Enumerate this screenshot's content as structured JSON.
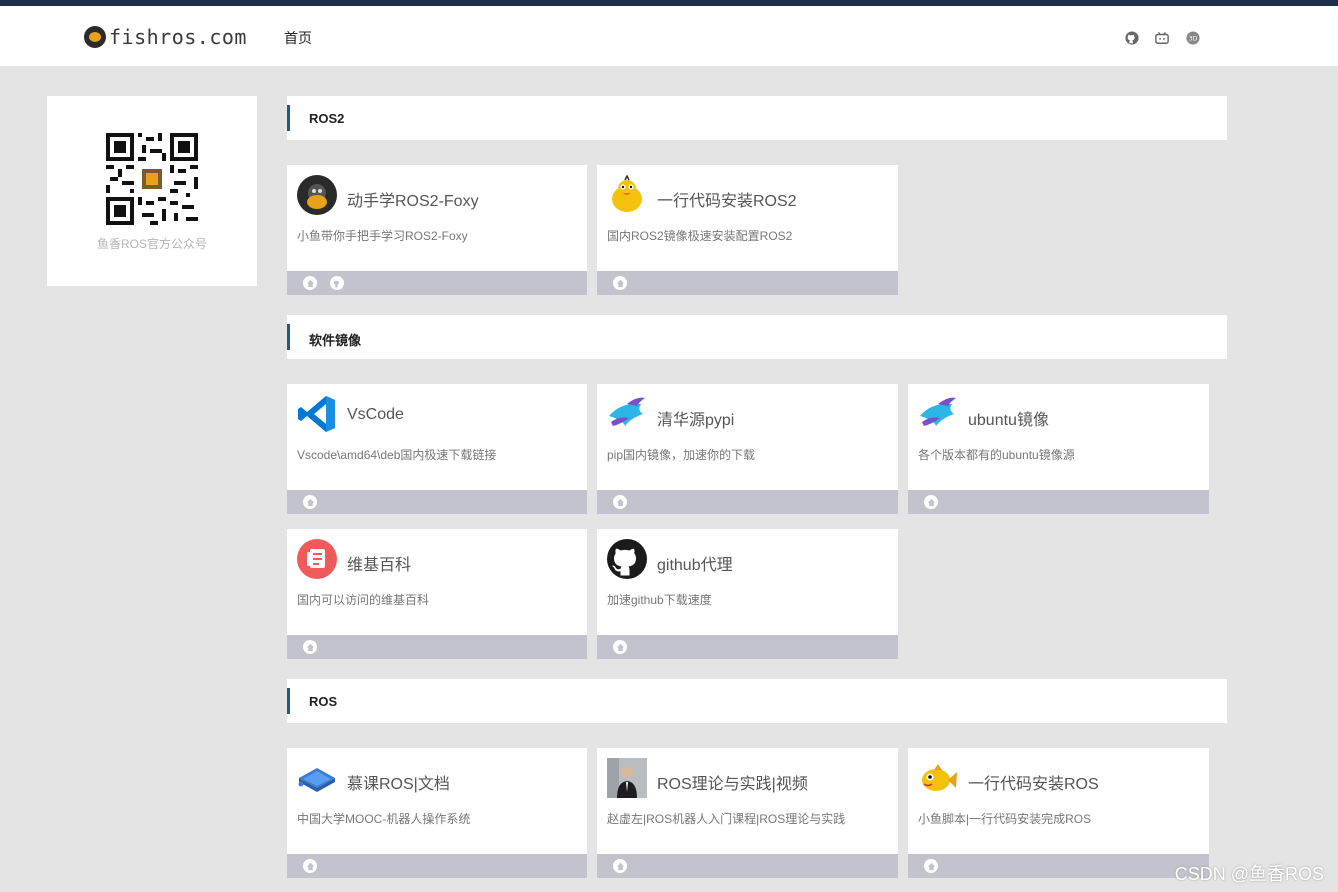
{
  "header": {
    "logo_text": "fishros.com",
    "nav_home": "首页",
    "icons": [
      "github-icon",
      "bilibili-icon",
      "blog-icon"
    ]
  },
  "sidebar": {
    "caption": "鱼香ROS官方公众号"
  },
  "sections": {
    "ros2": {
      "title": "ROS2"
    },
    "mirror": {
      "title": "软件镜像"
    },
    "ros": {
      "title": "ROS"
    }
  },
  "cards": {
    "foxy": {
      "name": "动手学ROS2-Foxy",
      "desc": "小鱼带你手把手学习ROS2-Foxy",
      "icon": "fishros-avatar-icon"
    },
    "install_ros2": {
      "name": "一行代码安装ROS2",
      "desc": "国内ROS2镜像极速安装配置ROS2",
      "icon": "duck-icon"
    },
    "vscode": {
      "name": "VsCode",
      "desc": "Vscode\\amd64\\deb国内极速下载链接",
      "icon": "vscode-icon"
    },
    "tsinghua": {
      "name": "清华源pypi",
      "desc": "pip国内镜像，加速你的下载",
      "icon": "tsinghua-fish-icon"
    },
    "ubuntu": {
      "name": "ubuntu镜像",
      "desc": "各个版本都有的ubuntu镜像源",
      "icon": "tsinghua-fish-icon"
    },
    "wiki": {
      "name": "维基百科",
      "desc": "国内可以访问的维基百科",
      "icon": "wiki-icon"
    },
    "github": {
      "name": "github代理",
      "desc": "加速github下载速度",
      "icon": "github-icon"
    },
    "mooc": {
      "name": "慕课ROS|文档",
      "desc": "中国大学MOOC-机器人操作系统",
      "icon": "book-icon"
    },
    "video": {
      "name": "ROS理论与实践|视频",
      "desc": "赵虚左|ROS机器人入门课程|ROS理论与实践",
      "icon": "person-photo-icon"
    },
    "install_ros": {
      "name": "一行代码安装ROS",
      "desc": "小鱼脚本|一行代码安装完成ROS",
      "icon": "fish-icon"
    }
  },
  "watermark": "CSDN @鱼香ROS",
  "colors": {
    "accent_bar": "#1f5d85",
    "top_stripe": "#1f2f4a",
    "card_footer": "#c3c3cd",
    "page_bg": "#e4e4e4"
  }
}
